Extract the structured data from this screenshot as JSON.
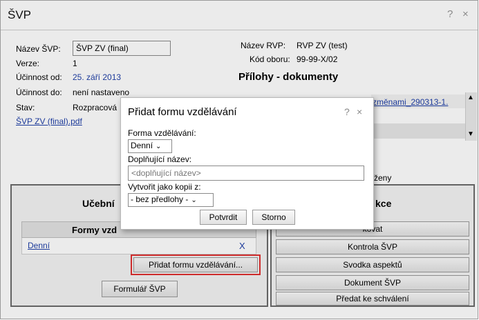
{
  "window": {
    "title": "ŠVP",
    "help": "?",
    "close": "×"
  },
  "info": {
    "name_label": "Název ŠVP:",
    "name_value": "ŠVP ZV (final)",
    "version_label": "Verze:",
    "version_value": "1",
    "valid_from_label": "Účinnost od:",
    "valid_from_value": "25. září 2013",
    "valid_to_label": "Účinnost do:",
    "valid_to_value": "není nastaveno",
    "status_label": "Stav:",
    "status_value": "Rozpracová",
    "file_link": "ŠVP ZV (final).pdf"
  },
  "rvp": {
    "name_label": "Název RVP:",
    "name_value": "RVP ZV (test)",
    "code_label": "Kód oboru:",
    "code_value": "99-99-X/02",
    "attachments_title": "Přílohy - dokumenty",
    "attachment_link": "změnami_290313-1.",
    "partial_text": "ženy"
  },
  "left_panel": {
    "title": "Učební",
    "table_header": "Formy vzd",
    "row_label": "Denní",
    "row_remove": "X",
    "add_form_button": "Přidat formu vzdělávání...",
    "form_button": "Formulář ŠVP"
  },
  "right_panel": {
    "title": "kce",
    "buttons": [
      "kovat",
      "Kontrola ŠVP",
      "Svodka aspektů",
      "Dokument ŠVP",
      "Předat ke schválení"
    ]
  },
  "dialog": {
    "title": "Přidat formu vzdělávání",
    "help": "?",
    "close": "×",
    "form_label": "Forma vzdělávání:",
    "form_value": "Denní",
    "extra_name_label": "Doplňující název:",
    "extra_name_placeholder": "<doplňující název>",
    "copy_label": "Vytvořit jako kopii z:",
    "copy_value": "- bez předlohy -",
    "confirm_button": "Potvrdit",
    "cancel_button": "Storno"
  },
  "colors": {
    "link": "#1f3fa8",
    "highlight": "#e03030"
  }
}
